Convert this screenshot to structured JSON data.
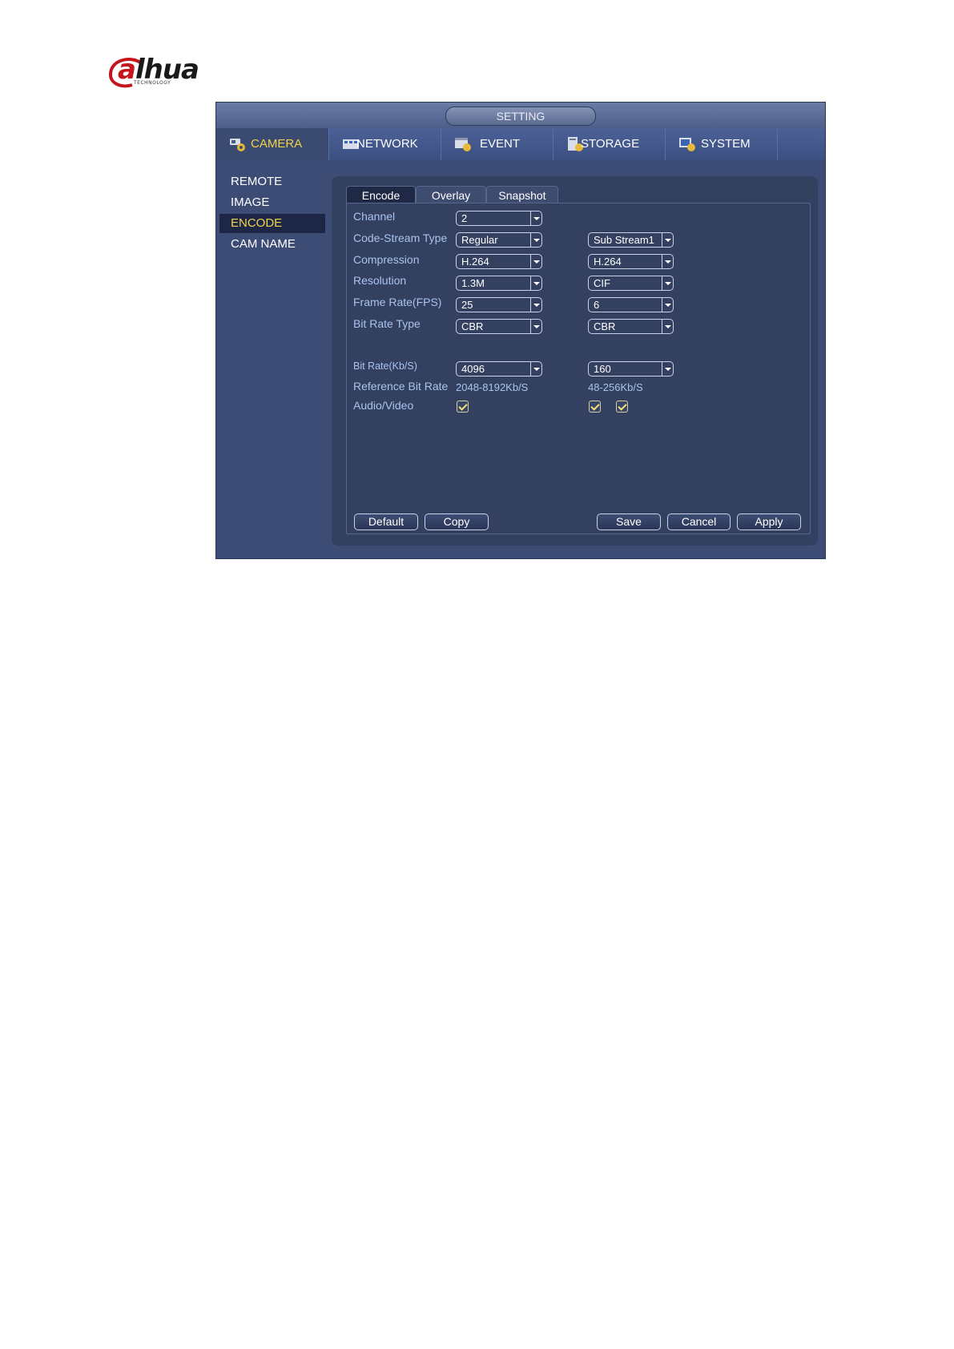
{
  "logo": {
    "brand": "alhua",
    "brand_a": "a",
    "brand_rest": "lhua",
    "tagline": "TECHNOLOGY"
  },
  "window": {
    "title": "SETTING"
  },
  "menu": [
    {
      "label": "CAMERA",
      "icon": "camera-settings-icon"
    },
    {
      "label": "NETWORK",
      "icon": "network-icon"
    },
    {
      "label": "EVENT",
      "icon": "event-icon"
    },
    {
      "label": "STORAGE",
      "icon": "storage-icon"
    },
    {
      "label": "SYSTEM",
      "icon": "system-icon"
    }
  ],
  "sidebar": {
    "items": [
      {
        "label": "REMOTE"
      },
      {
        "label": "IMAGE"
      },
      {
        "label": "ENCODE"
      },
      {
        "label": "CAM NAME"
      }
    ],
    "active": "ENCODE"
  },
  "subtabs": [
    {
      "label": "Encode"
    },
    {
      "label": "Overlay"
    },
    {
      "label": "Snapshot"
    }
  ],
  "form": {
    "channel": {
      "label": "Channel",
      "value": "2"
    },
    "code_stream_type": {
      "label": "Code-Stream Type",
      "main": "Regular",
      "sub": "Sub Stream1"
    },
    "compression": {
      "label": "Compression",
      "main": "H.264",
      "sub": "H.264"
    },
    "resolution": {
      "label": "Resolution",
      "main": "1.3M",
      "sub": "CIF"
    },
    "frame_rate": {
      "label": "Frame Rate(FPS)",
      "main": "25",
      "sub": "6"
    },
    "bit_rate_type": {
      "label": "Bit Rate Type",
      "main": "CBR",
      "sub": "CBR"
    },
    "bit_rate": {
      "label": "Bit Rate(Kb/S)",
      "main": "4096",
      "sub": "160"
    },
    "reference_bit_rate": {
      "label": "Reference Bit Rate",
      "main": "2048-8192Kb/S",
      "sub": "48-256Kb/S"
    },
    "audio_video": {
      "label": "Audio/Video",
      "main_video": true,
      "sub_video": true,
      "sub_audio": true
    }
  },
  "buttons": {
    "default": "Default",
    "copy": "Copy",
    "save": "Save",
    "cancel": "Cancel",
    "apply": "Apply"
  },
  "colors": {
    "window_bg": "#3c4c74",
    "accent_yellow": "#f1d24a",
    "label_blue": "#a9c3ef"
  }
}
